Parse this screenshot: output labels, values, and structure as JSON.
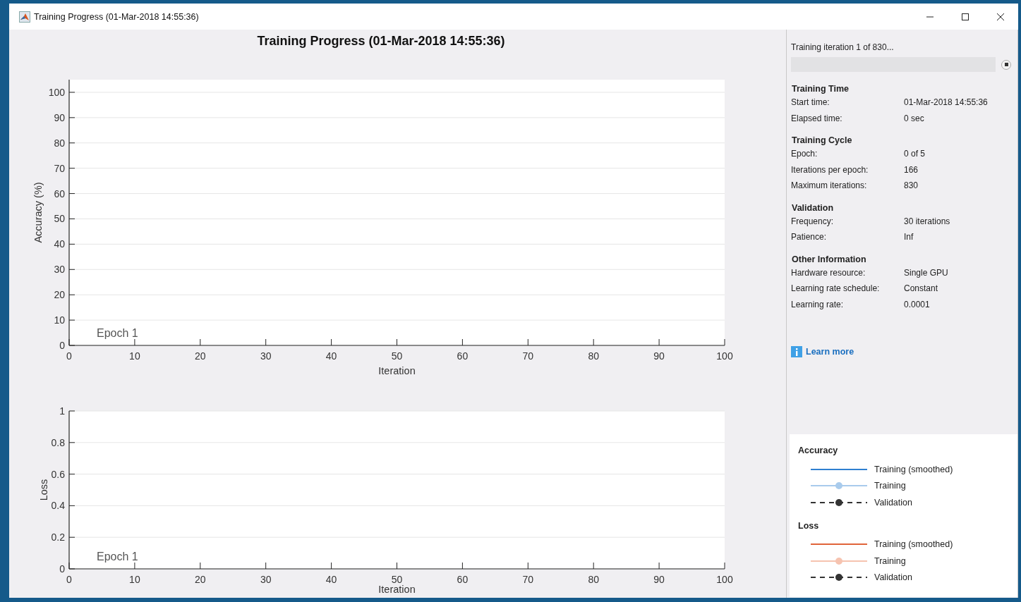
{
  "window": {
    "title": "Training Progress (01-Mar-2018 14:55:36)"
  },
  "plot_title": "Training Progress (01-Mar-2018 14:55:36)",
  "charts": [
    {
      "chart_data": {
        "type": "line",
        "xlabel": "Iteration",
        "ylabel": "Accuracy (%)",
        "xlim": [
          0,
          100
        ],
        "ylim": [
          0,
          105
        ],
        "xticks": [
          0,
          10,
          20,
          30,
          40,
          50,
          60,
          70,
          80,
          90,
          100
        ],
        "yticks": [
          0,
          10,
          20,
          30,
          40,
          50,
          60,
          70,
          80,
          90,
          100
        ],
        "grid": true,
        "annotations": [
          "Epoch 1"
        ]
      }
    },
    {
      "chart_data": {
        "type": "line",
        "xlabel": "Iteration",
        "ylabel": "Loss",
        "xlim": [
          0,
          100
        ],
        "ylim": [
          0,
          1
        ],
        "xticks": [
          0,
          10,
          20,
          30,
          40,
          50,
          60,
          70,
          80,
          90,
          100
        ],
        "yticks": [
          0,
          0.2,
          0.4,
          0.6,
          0.8,
          1
        ],
        "grid": true,
        "annotations": [
          "Epoch 1"
        ]
      }
    }
  ],
  "progress": {
    "text": "Training iteration 1 of 830...",
    "level": 0
  },
  "sections": [
    {
      "heading": "Training Time",
      "rows": [
        {
          "label": "Start time:",
          "value": "01-Mar-2018 14:55:36"
        },
        {
          "label": "Elapsed time:",
          "value": "0 sec"
        }
      ]
    },
    {
      "heading": "Training Cycle",
      "rows": [
        {
          "label": "Epoch:",
          "value": "0 of 5"
        },
        {
          "label": "Iterations per epoch:",
          "value": "166"
        },
        {
          "label": "Maximum iterations:",
          "value": "830"
        }
      ]
    },
    {
      "heading": "Validation",
      "rows": [
        {
          "label": "Frequency:",
          "value": "30 iterations"
        },
        {
          "label": "Patience:",
          "value": "Inf"
        }
      ]
    },
    {
      "heading": "Other Information",
      "rows": [
        {
          "label": "Hardware resource:",
          "value": "Single GPU"
        },
        {
          "label": "Learning rate schedule:",
          "value": "Constant"
        },
        {
          "label": "Learning rate:",
          "value": "0.0001"
        }
      ]
    }
  ],
  "learn_more": "Learn more",
  "legend": [
    {
      "heading": "Accuracy",
      "entries": [
        {
          "kind": "smoothed",
          "color": "#2f7fd0",
          "label": "Training (smoothed)"
        },
        {
          "kind": "raw",
          "color": "#a9cbec",
          "label": "Training"
        },
        {
          "kind": "validation",
          "color": "#333333",
          "label": "Validation"
        }
      ]
    },
    {
      "heading": "Loss",
      "entries": [
        {
          "kind": "smoothed",
          "color": "#e0643a",
          "label": "Training (smoothed)"
        },
        {
          "kind": "raw",
          "color": "#f6c3b0",
          "label": "Training"
        },
        {
          "kind": "validation",
          "color": "#333333",
          "label": "Validation"
        }
      ]
    }
  ]
}
